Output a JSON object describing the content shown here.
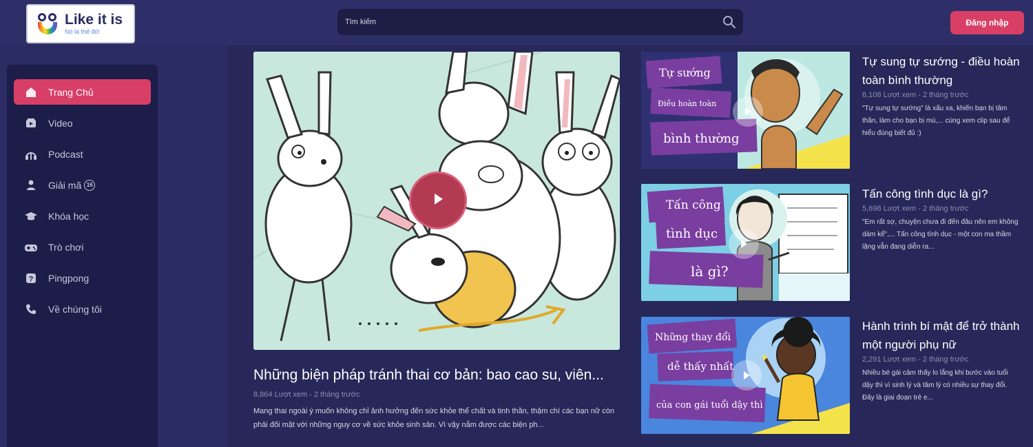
{
  "header": {
    "logo_title": "Like it is",
    "logo_subtitle": "Nó là thế đó!",
    "search_placeholder": "Tìm kiếm",
    "login_label": "Đăng nhập"
  },
  "colors": {
    "accent": "#d83f66",
    "background": "#2b2c63",
    "sidebar": "#1d1d4a",
    "search_bg": "#1d1d45"
  },
  "sidebar": {
    "items": [
      {
        "label": "Trang Chủ",
        "icon": "home-icon",
        "active": true
      },
      {
        "label": "Video",
        "icon": "video-icon",
        "active": false
      },
      {
        "label": "Podcast",
        "icon": "podcast-icon",
        "active": false
      },
      {
        "label": "Giải mã",
        "icon": "decode-icon",
        "badge": "16",
        "active": false
      },
      {
        "label": "Khóa học",
        "icon": "graduation-cap-icon",
        "active": false
      },
      {
        "label": "Trò chơi",
        "icon": "gamepad-icon",
        "active": false
      },
      {
        "label": "Pingpong",
        "icon": "question-icon",
        "active": false
      },
      {
        "label": "Về chúng tôi",
        "icon": "phone-icon",
        "active": false
      }
    ]
  },
  "featured": {
    "title": "Những biện pháp tránh thai cơ bản: bao cao su, viên...",
    "meta": "8,864 Lượt xem - 2 tháng trước",
    "description": "Mang thai ngoài ý muốn không chỉ ảnh hưởng đến sức khỏe thể chất và tinh thần, thậm chí các bạn nữ còn phải đối mặt với những nguy cơ về sức khỏe sinh sản. Vì vậy nắm được các biện ph..."
  },
  "videos": [
    {
      "title": "Tự sung tự sướng - điều hoàn toàn bình thường",
      "meta": "6,108 Lượt xem - 2 tháng trước",
      "description": "\"Tự sung tự sướng\" là xấu xa, khiến bạn bị tâm thần, làm cho bạn bị mù,... cùng xem clip sau để hiểu đúng biết đủ :)",
      "thumb_lines": [
        "Tự sướng",
        "Điều hoàn toàn",
        "bình thường"
      ]
    },
    {
      "title": "Tấn công tình dục là gì?",
      "meta": "5,698 Lượt xem - 2 tháng trước",
      "description": "\"Em rất sợ, chuyện chưa đi đến đâu nên em không dám kể\",... Tấn công tình dục - một con ma thầm lặng vẫn đang diễn ra...",
      "thumb_lines": [
        "Tấn công",
        "tình dục",
        "là gì?"
      ]
    },
    {
      "title": "Hành trình bí mật để trở thành một người phụ nữ",
      "meta": "2,291 Lượt xem - 2 tháng trước",
      "description": "Nhiều bé gái cảm thấy lo lắng khi bước vào tuổi dậy thì vì sinh lý và tâm lý có nhiều sự thay đổi. Đây là giai đoạn trẻ e...",
      "thumb_lines": [
        "Những thay đổi",
        "dễ thấy nhất",
        "của con gái tuổi dậy thì"
      ]
    }
  ]
}
